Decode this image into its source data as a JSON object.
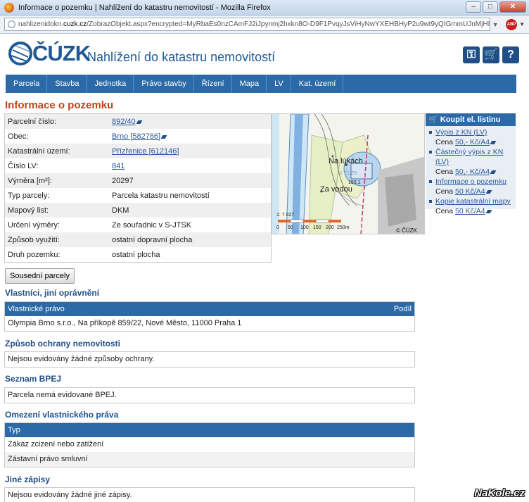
{
  "window": {
    "title": "Informace o pozemku | Nahlížení do katastru nemovitostí - Mozilla Firefox",
    "minimize": "–",
    "maximize": "□",
    "close": "✕"
  },
  "urlbar": {
    "url_prefix": "nahlizenidokn.",
    "url_domain": "cuzk.cz",
    "url_rest": "/ZobrazObjekt.aspx?encrypted=MyRbaEs0nzCAmFJ2iJpynmj2hxkn8O-D9F1PvqyJsViHyNwYXEHBHyP2u9wt9yQIGmmUJnMjHI3I0poJXcSgo7bCdENyJ52nrv2q:",
    "abp": "ABP"
  },
  "header": {
    "logo_text": "ČÚZK",
    "site_title": "Nahlížení do katastru nemovitostí",
    "icons": [
      "key-icon",
      "cart-icon",
      "help-icon"
    ]
  },
  "nav": [
    "Parcela",
    "Stavba",
    "Jednotka",
    "Právo stavby",
    "Řízení",
    "Mapa",
    "LV",
    "Kat. území"
  ],
  "page_title": "Informace o pozemku",
  "parcel": [
    {
      "key": "Parcelní číslo:",
      "value": "892/40",
      "link": true,
      "mark": true
    },
    {
      "key": "Obec:",
      "value": "Brno [582786]",
      "link": true,
      "mark": true
    },
    {
      "key": "Katastrální území:",
      "value": "Přízřenice [612146]",
      "link": true,
      "mark": false
    },
    {
      "key": "Číslo LV:",
      "value": "841",
      "link": true,
      "mark": false
    },
    {
      "key": "Výměra [m²]:",
      "value": "20297",
      "link": false,
      "mark": false
    },
    {
      "key": "Typ parcely:",
      "value": "Parcela katastru nemovitostí",
      "link": false,
      "mark": false
    },
    {
      "key": "Mapový list:",
      "value": "DKM",
      "link": false,
      "mark": false
    },
    {
      "key": "Určení výměry:",
      "value": "Ze souřadnic v S-JTSK",
      "link": false,
      "mark": false
    },
    {
      "key": "Způsob využití:",
      "value": "ostatní dopravní plocha",
      "link": false,
      "mark": false
    },
    {
      "key": "Druh pozemku:",
      "value": "ostatní plocha",
      "link": false,
      "mark": false
    }
  ],
  "map": {
    "label1": "Na lúkách",
    "label2": "Za vodou",
    "logo": "© ČÚZK",
    "number": "193,1",
    "scale_ratio": "1: 7 027",
    "scale_ticks": [
      "0",
      "50",
      "100",
      "150",
      "200",
      "250m"
    ],
    "copyright": "© ČÚZK"
  },
  "buy": {
    "title": "Koupit el. listinu",
    "items": [
      {
        "label": "Výpis z KN (LV)",
        "price_prefix": "Cena ",
        "price": "50,- Kč/A4"
      },
      {
        "label": "Částečný výpis z KN (LV)",
        "price_prefix": "Cena ",
        "price": "50,- Kč/A4"
      },
      {
        "label": "Informace o pozemku",
        "price_prefix": "Cena ",
        "price": "50 Kč/A4"
      },
      {
        "label": "Kopie katastrální mapy",
        "price_prefix": "Cena ",
        "price": "50 Kč/A4"
      }
    ]
  },
  "neighbors_button": "Sousední parcely",
  "owners": {
    "title": "Vlastníci, jiní oprávnění",
    "col1": "Vlastnické právo",
    "col2": "Podíl",
    "row": "Olympia Brno s.r.o., Na příkopě 859/22, Nové Město, 11000 Praha 1"
  },
  "protection": {
    "title": "Způsob ochrany nemovitosti",
    "row": "Nejsou evidovány žádné způsoby ochrany."
  },
  "bpej": {
    "title": "Seznam BPEJ",
    "row": "Parcela nemá evidované BPEJ."
  },
  "restrictions": {
    "title": "Omezení vlastnického práva",
    "col": "Typ",
    "rows": [
      "Zákaz zcizení nebo zatížení",
      "Zástavní právo smluvní"
    ]
  },
  "other": {
    "title": "Jiné zápisy",
    "row": "Nejsou evidovány žádné jiné zápisy."
  },
  "watermark": "NaKole.cz"
}
